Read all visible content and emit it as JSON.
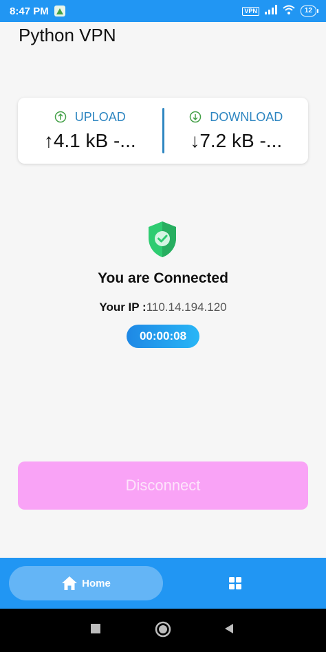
{
  "status_bar": {
    "time": "8:47 PM",
    "vpn_badge": "VPN",
    "battery": "12",
    "icons": [
      "app-notification-icon",
      "vpn-icon",
      "signal-icon",
      "wifi-icon",
      "battery-icon"
    ]
  },
  "app": {
    "title": "Python VPN"
  },
  "stats": {
    "upload_label": "UPLOAD",
    "upload_value": "↑4.1 kB -...",
    "download_label": "DOWNLOAD",
    "download_value": "↓7.2 kB -..."
  },
  "status": {
    "connected_text": "You are Connected",
    "ip_label": "Your IP :",
    "ip_value": "110.14.194.120",
    "timer": "00:00:08"
  },
  "actions": {
    "disconnect_label": "Disconnect"
  },
  "bottom_nav": {
    "home_label": "Home",
    "items": [
      "home-icon",
      "grid-icon"
    ]
  },
  "colors": {
    "primary": "#2196f3",
    "accent_text": "#2e86c1",
    "shield": "#2ecc71",
    "disconnect_bg": "#f9a3f6"
  }
}
